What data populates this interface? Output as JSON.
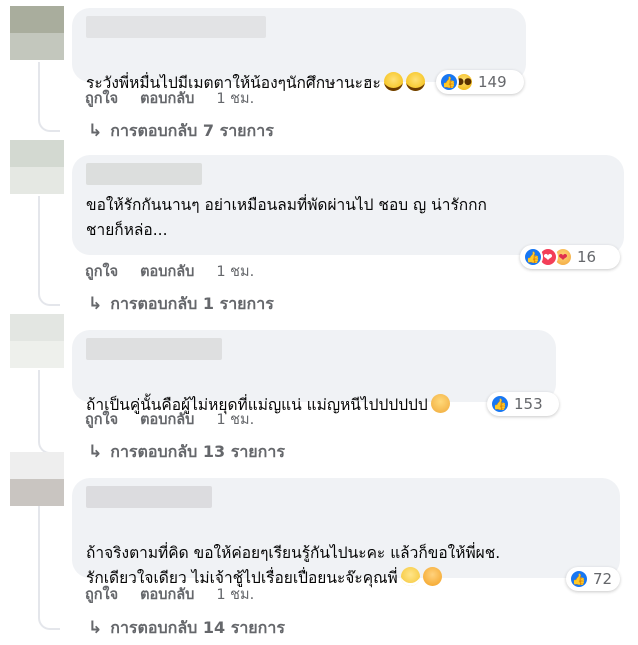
{
  "comments": [
    {
      "text": "ระวังพี่หมื่นไปมีเมตตาให้น้องๆนักศึกษานะฮะ",
      "emojis": [
        "laughing-emoji",
        "laughing-emoji"
      ],
      "reactions": [
        "like",
        "haha"
      ],
      "count": "149",
      "like_label": "ถูกใจ",
      "reply_label": "ตอบกลับ",
      "time": "1 ชม.",
      "replies_label": "การตอบกลับ 7 รายการ"
    },
    {
      "text": "ขอให้รักกันนานๆ อย่าเหมือนลมที่พัดผ่านไป ชอบ ญ น่ารักกก\nชายก็หล่อ...",
      "emojis": [],
      "reactions": [
        "like",
        "love",
        "care"
      ],
      "count": "16",
      "like_label": "ถูกใจ",
      "reply_label": "ตอบกลับ",
      "time": "1 ชม.",
      "replies_label": "การตอบกลับ 1 รายการ"
    },
    {
      "text": "ถ้าเป็นคู่นั้นคือผู้ไม่หยุดที่แม่ญแน่ แม่ญหนีไปปปปปป",
      "emojis": [
        "pouting-emoji"
      ],
      "reactions": [
        "like"
      ],
      "count": "153",
      "like_label": "ถูกใจ",
      "reply_label": "ตอบกลับ",
      "time": "1 ชม.",
      "replies_label": "การตอบกลับ 13 รายการ"
    },
    {
      "text": "ถ้าจริงตามที่คิด ขอให้ค่อยๆเรียนรู้กันไปนะคะ แล้วก็ขอให้พี่ผช.\nรักเดียวใจเดียว ไม่เจ้าชู้ไปเรื่อยเปื่อยนะจ๊ะคุณพี่",
      "emojis": [
        "grinning-emoji",
        "smiling-hearts-emoji"
      ],
      "reactions": [
        "like"
      ],
      "count": "72",
      "like_label": "ถูกใจ",
      "reply_label": "ตอบกลับ",
      "time": "1 ชม.",
      "replies_label": "การตอบกลับ 14 รายการ"
    }
  ],
  "colors": {
    "bubble": "#f0f2f5",
    "muted_text": "#65676b",
    "like_blue": "#1877f2",
    "love_red": "#f33e58"
  }
}
